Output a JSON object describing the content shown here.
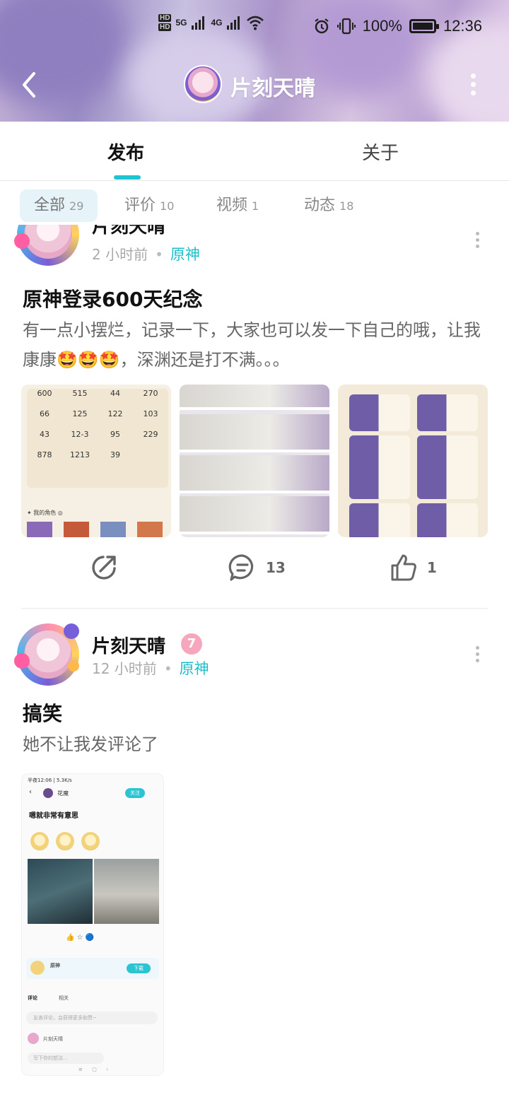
{
  "status_bar": {
    "hd1": "HD",
    "hd2": "HD",
    "net1": "5G",
    "net2": "4G",
    "battery": "100%",
    "time": "12:36"
  },
  "nav": {
    "title": "片刻天晴"
  },
  "main_tabs": [
    {
      "label": "发布",
      "active": true
    },
    {
      "label": "关于",
      "active": false
    }
  ],
  "filters": [
    {
      "label": "全部",
      "count": "29",
      "active": true
    },
    {
      "label": "评价",
      "count": "10",
      "active": false
    },
    {
      "label": "视频",
      "count": "1",
      "active": false
    },
    {
      "label": "动态",
      "count": "18",
      "active": false
    }
  ],
  "posts": [
    {
      "author": "片刻天晴",
      "time": "2 小时前",
      "game": "原神",
      "title": "原神登录600天纪念",
      "body": "有一点小摆烂，记录一下，大家也可以发一下自己的哦，让我康康🤩🤩🤩，深渊还是打不满。。。",
      "stats": [
        "600",
        "515",
        "44",
        "270",
        "66",
        "125",
        "122",
        "103",
        "43",
        "12-3",
        "95",
        "229",
        "878",
        "1213",
        "39"
      ],
      "comments": "13",
      "likes": "1"
    },
    {
      "author": "片刻天晴",
      "badge": "7",
      "time": "12 小时前",
      "game": "原神",
      "title": "搞笑",
      "body": "她不让我发评论了",
      "shot": {
        "status": "半夜12:06 | 5.3K/s",
        "name": "花魔",
        "follow": "关注",
        "title": "嗯就非常有意思",
        "app": "原神",
        "download": "下载",
        "comment_tab": "评论",
        "related_tab": "相关",
        "input": "写下你的想法...",
        "comment_hint": "友善评论，会获得更多助赞~",
        "commenter": "片刻天晴"
      }
    }
  ]
}
